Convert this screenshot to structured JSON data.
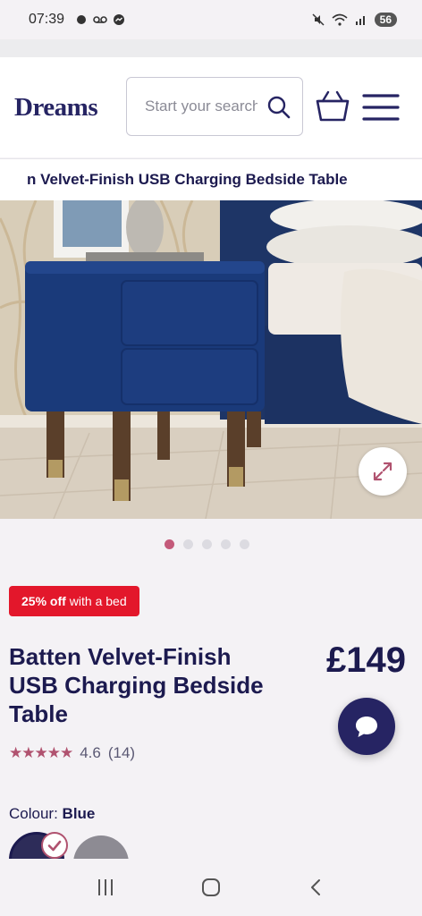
{
  "status_bar": {
    "time": "07:39",
    "battery": "56"
  },
  "header": {
    "logo": "Dreams",
    "search_placeholder": "Start your search"
  },
  "title_strip": {
    "text": "n Velvet-Finish USB Charging Bedside Table"
  },
  "gallery": {
    "dot_count": 5,
    "active_index": 0
  },
  "product": {
    "badge_bold": "25% off",
    "badge_rest": "with a bed",
    "title": "Batten Velvet-Finish USB Charging Bedside Table",
    "price": "£149",
    "stars": "★★★★★",
    "rating_value": "4.6",
    "rating_count": "(14)",
    "colour_label": "Colour:",
    "colour_value": "Blue"
  },
  "colors": {
    "brand": "#262463",
    "accent": "#c45a7a",
    "badge": "#e3172b"
  },
  "icons": [
    "search-icon",
    "basket-icon",
    "menu-icon",
    "expand-icon",
    "chat-icon",
    "recents-icon",
    "home-icon",
    "back-icon"
  ]
}
